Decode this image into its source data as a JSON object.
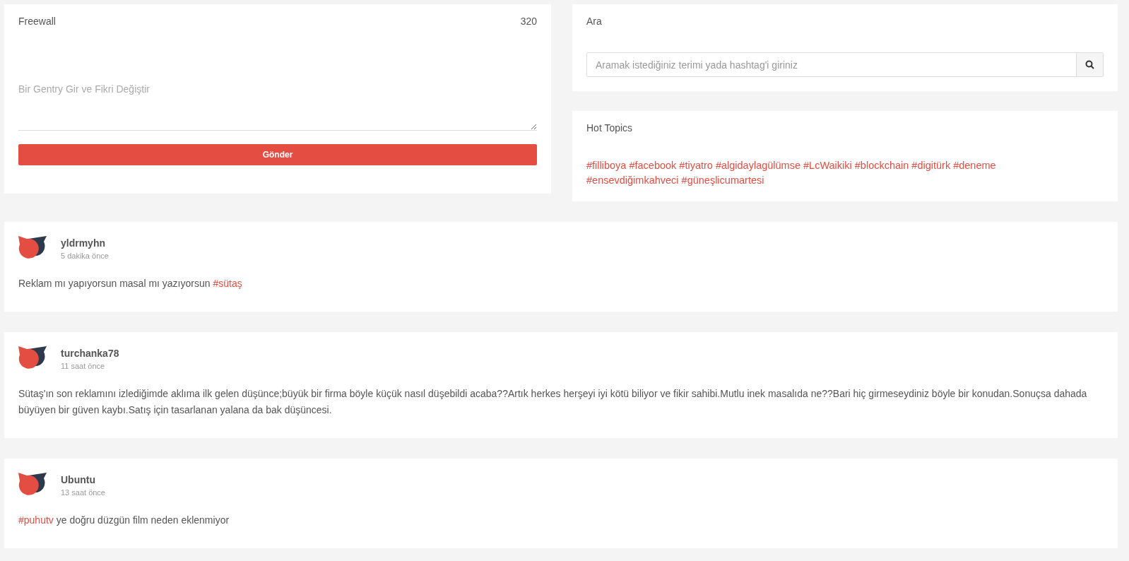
{
  "freewall": {
    "title": "Freewall",
    "count": "320",
    "placeholder": "Bir Gentry Gir ve Fikri Değiştir",
    "button": "Gönder"
  },
  "search": {
    "title": "Ara",
    "placeholder": "Aramak istediğiniz terimi yada hashtag'i giriniz"
  },
  "hot_topics": {
    "title": "Hot Topics",
    "tags": [
      "#filliboya",
      "#facebook",
      "#tiyatro",
      "#algidaylagülümse",
      "#LcWaikiki",
      "#blockchain",
      "#digitürk",
      "#deneme",
      "#ensevdiğimkahveci",
      "#güneşlicumartesi"
    ]
  },
  "posts": [
    {
      "user": "yldrmyhn",
      "time": "5 dakika önce",
      "body": [
        {
          "kind": "text",
          "text": "Reklam mı yapıyorsun masal mı yazıyorsun "
        },
        {
          "kind": "hashtag",
          "text": "#sütaş"
        }
      ]
    },
    {
      "user": "turchanka78",
      "time": "11 saat önce",
      "body": [
        {
          "kind": "text",
          "text": "Sütaş'ın son reklamını izlediğimde aklıma ilk gelen düşünce;büyük bir firma böyle küçük nasıl düşebildi acaba??Artık herkes herşeyi iyi kötü biliyor ve fikir sahibi.Mutlu inek masalıda ne??Bari hiç girmeseydiniz böyle bir konudan.Sonuçsa dahada büyüyen bir güven kaybı.Satış için tasarlanan yalana da bak düşüncesi."
        }
      ]
    },
    {
      "user": "Ubuntu",
      "time": "13 saat önce",
      "body": [
        {
          "kind": "hashtag",
          "text": "#puhutv"
        },
        {
          "kind": "text",
          "text": " ye doğru düzgün film neden eklenmiyor"
        }
      ]
    }
  ]
}
